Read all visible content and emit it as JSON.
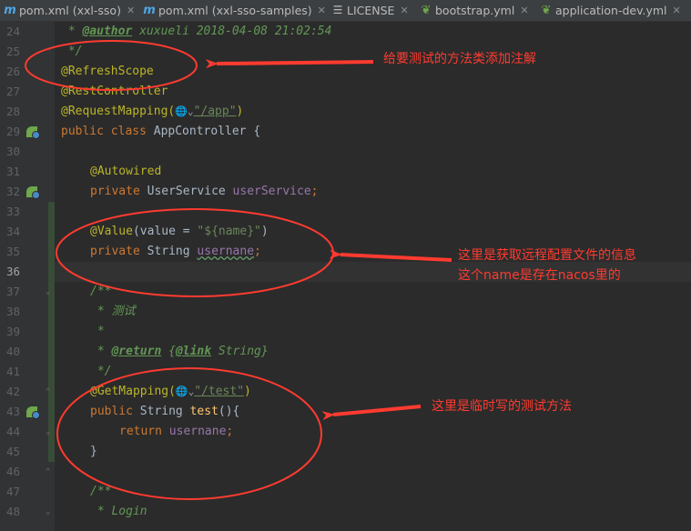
{
  "tabs": [
    {
      "label": "pom.xml (xxl-sso)",
      "icon": "m"
    },
    {
      "label": "pom.xml (xxl-sso-samples)",
      "icon": "m"
    },
    {
      "label": "LICENSE",
      "icon": "license"
    },
    {
      "label": "bootstrap.yml",
      "icon": "leaf"
    },
    {
      "label": "application-dev.yml",
      "icon": "leaf"
    }
  ],
  "gutter": {
    "line_numbers": [
      "24",
      "25",
      "26",
      "27",
      "28",
      "29",
      "30",
      "31",
      "32",
      "33",
      "34",
      "35",
      "36",
      "37",
      "38",
      "39",
      "40",
      "41",
      "42",
      "43",
      "44",
      "45",
      "46",
      "47",
      "48"
    ],
    "current_line": "36"
  },
  "code": {
    "l24": {
      "star": " * ",
      "tag": "@author",
      "rest": " xuxueli 2018-04-08 21:02:54"
    },
    "l25": " */",
    "l26": "@RefreshScope",
    "l27": "@RestController",
    "l28": {
      "ann": "@RequestMapping(",
      "globe": "🌐⌄",
      "str": "\"/app\"",
      "close": ")"
    },
    "l29": {
      "kw": "public class ",
      "name": "AppController {"
    },
    "l31": "@Autowired",
    "l32": {
      "kw": "private ",
      "type": "UserService ",
      "field": "userService",
      "semi": ";"
    },
    "l34": {
      "ann": "@Value",
      "open": "(value = ",
      "str": "\"${name}\"",
      "close": ")"
    },
    "l35": {
      "kw": "private ",
      "type": "String ",
      "field": "usernane",
      "semi": ";"
    },
    "l37": "/**",
    "l38": " * 测试",
    "l39": " *",
    "l40": {
      "star": " * ",
      "tag": "@return",
      "sp": " {",
      "link": "@link",
      "rest": " String}"
    },
    "l41": " */",
    "l42": {
      "ann": "@GetMapping(",
      "globe": "🌐⌄",
      "str": "\"/test\"",
      "close": ")"
    },
    "l43": {
      "kw": "public ",
      "type": "String ",
      "fn": "test",
      "rest": "(){"
    },
    "l44": {
      "kw": "return ",
      "field": "usernane",
      "semi": ";"
    },
    "l45": "}",
    "l47": "/**",
    "l48": " * Login"
  },
  "annotations": {
    "note1": "给要测试的方法类添加注解",
    "note2_line1": "这里是获取远程配置文件的信息",
    "note2_line2": "这个name是存在nacos里的",
    "note3": "这里是临时写的测试方法"
  },
  "colors": {
    "annotation_red": "#ff3b30",
    "editor_bg": "#2b2b2b",
    "keyword": "#cc7832",
    "annotation": "#bbb529",
    "string": "#6a8759",
    "field": "#9876aa"
  }
}
